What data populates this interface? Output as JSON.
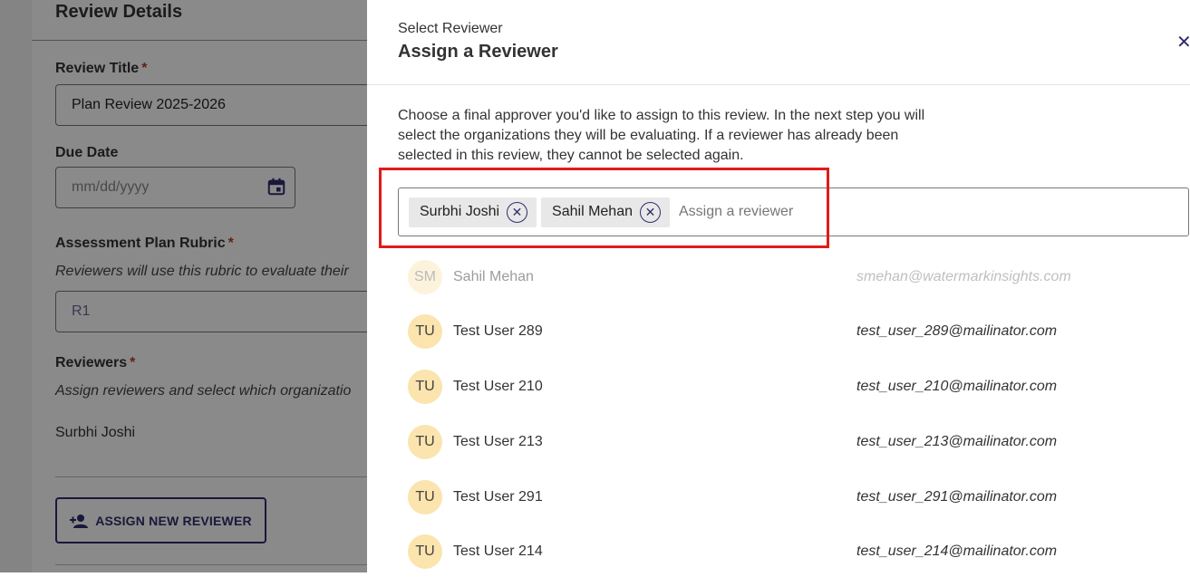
{
  "background": {
    "heading": "Review Details",
    "review_title_label": "Review Title",
    "review_title_value": "Plan Review 2025-2026",
    "due_date_label": "Due Date",
    "due_date_placeholder": "mm/dd/yyyy",
    "rubric_label": "Assessment Plan Rubric",
    "rubric_help": "Reviewers will use this rubric to evaluate their",
    "rubric_value": "R1",
    "reviewers_label": "Reviewers",
    "reviewers_help": "Assign reviewers and select which organizatio",
    "reviewer_name": "Surbhi Joshi",
    "assign_button": "ASSIGN NEW REVIEWER",
    "required_mark": "*"
  },
  "drawer": {
    "subtitle": "Select Reviewer",
    "title": "Assign a Reviewer",
    "close_glyph": "✕",
    "description": "Choose a final approver you'd like to assign to this review. In the next step you will select the organizations they will be evaluating. If a reviewer has already been selected in this review, they cannot be selected again.",
    "chips": [
      {
        "label": "Surbhi Joshi"
      },
      {
        "label": "Sahil Mehan"
      }
    ],
    "chip_remove_glyph": "✕",
    "input_placeholder": "Assign a reviewer",
    "options": [
      {
        "initials": "SM",
        "name": "Sahil Mehan",
        "email": "smehan@watermarkinsights.com",
        "disabled": true
      },
      {
        "initials": "TU",
        "name": "Test User 289",
        "email": "test_user_289@mailinator.com",
        "disabled": false
      },
      {
        "initials": "TU",
        "name": "Test User 210",
        "email": "test_user_210@mailinator.com",
        "disabled": false
      },
      {
        "initials": "TU",
        "name": "Test User 213",
        "email": "test_user_213@mailinator.com",
        "disabled": false
      },
      {
        "initials": "TU",
        "name": "Test User 291",
        "email": "test_user_291@mailinator.com",
        "disabled": false
      },
      {
        "initials": "TU",
        "name": "Test User 214",
        "email": "test_user_214@mailinator.com",
        "disabled": false
      }
    ]
  },
  "colors": {
    "accent": "#2f2d6e",
    "highlight": "#e01b1b",
    "avatar": "#fbe4ad",
    "required": "#c0392b"
  }
}
